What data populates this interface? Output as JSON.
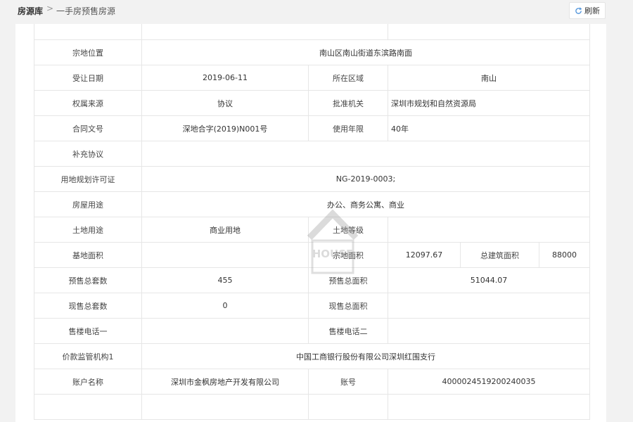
{
  "breadcrumb": {
    "root": "房源库",
    "separator": ">",
    "current": "一手房预售房源"
  },
  "toolbar": {
    "refresh_label": "刷新"
  },
  "watermark": {
    "text": "HOUSE"
  },
  "table": {
    "land_location_label": "宗地位置",
    "land_location_value": "南山区南山街道东滨路南面",
    "transfer_date_label": "受让日期",
    "transfer_date_value": "2019-06-11",
    "district_label": "所在区域",
    "district_value": "南山",
    "ownership_source_label": "权属来源",
    "ownership_source_value": "协议",
    "approval_authority_label": "批准机关",
    "approval_authority_value": "深圳市规划和自然资源局",
    "contract_no_label": "合同文号",
    "contract_no_value": "深地合字(2019)N001号",
    "usage_period_label": "使用年限",
    "usage_period_value": "40年",
    "supplement_label": "补充协议",
    "supplement_value": "",
    "land_permit_label": "用地规划许可证",
    "land_permit_value": "NG-2019-0003;",
    "house_use_label": "房屋用途",
    "house_use_value": "办公、商务公寓、商业",
    "land_use_label": "土地用途",
    "land_use_value": "商业用地",
    "land_grade_label": "土地等级",
    "land_grade_value": "",
    "base_area_label": "基地面积",
    "base_area_value": "",
    "parcel_area_label": "宗地面积",
    "parcel_area_value": "12097.67",
    "total_floor_area_label": "总建筑面积",
    "total_floor_area_value": "88000",
    "presale_units_label": "预售总套数",
    "presale_units_value": "455",
    "presale_area_label": "预售总面积",
    "presale_area_value": "51044.07",
    "current_units_label": "现售总套数",
    "current_units_value": "0",
    "current_area_label": "现售总面积",
    "current_area_value": "",
    "sales_phone1_label": "售楼电话一",
    "sales_phone1_value": "",
    "sales_phone2_label": "售楼电话二",
    "sales_phone2_value": "",
    "escrow_label": "价款监管机构1",
    "escrow_value": "中国工商银行股份有限公司深圳红围支行",
    "account_name_label": "账户名称",
    "account_name_value": "深圳市金枫房地产开发有限公司",
    "account_no_label": "账号",
    "account_no_value": "4000024519200240035"
  }
}
